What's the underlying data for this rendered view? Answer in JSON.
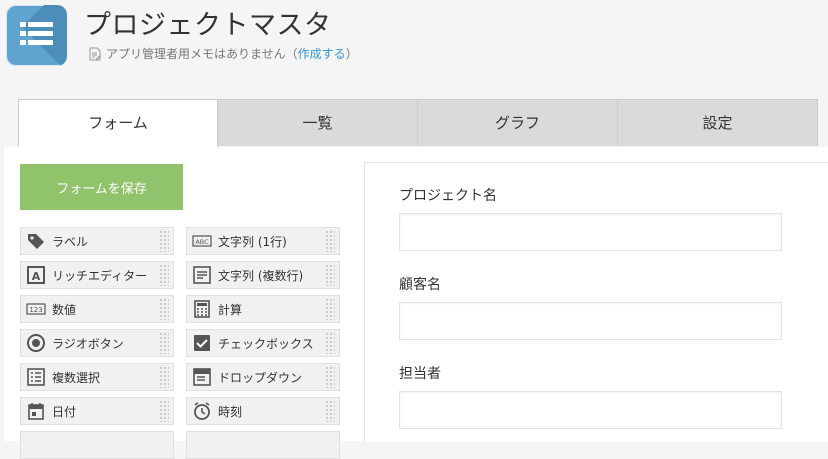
{
  "header": {
    "title": "プロジェクトマスタ",
    "memo_text": "アプリ管理者用メモはありません",
    "memo_open": "（",
    "memo_link": "作成する",
    "memo_close": "）"
  },
  "tabs": [
    {
      "label": "フォーム",
      "active": true
    },
    {
      "label": "一覧",
      "active": false
    },
    {
      "label": "グラフ",
      "active": false
    },
    {
      "label": "設定",
      "active": false
    }
  ],
  "toolbar": {
    "save_label": "フォームを保存"
  },
  "palette": [
    {
      "label": "ラベル",
      "icon": "tag-icon"
    },
    {
      "label": "文字列 (1行)",
      "icon": "abc-icon"
    },
    {
      "label": "リッチエディター",
      "icon": "rich-editor-icon"
    },
    {
      "label": "文字列 (複数行)",
      "icon": "multiline-text-icon"
    },
    {
      "label": "数値",
      "icon": "number-123-icon"
    },
    {
      "label": "計算",
      "icon": "calculator-icon"
    },
    {
      "label": "ラジオボタン",
      "icon": "radio-icon"
    },
    {
      "label": "チェックボックス",
      "icon": "checkbox-icon"
    },
    {
      "label": "複数選択",
      "icon": "multi-select-icon"
    },
    {
      "label": "ドロップダウン",
      "icon": "dropdown-icon"
    },
    {
      "label": "日付",
      "icon": "calendar-icon"
    },
    {
      "label": "時刻",
      "icon": "clock-icon"
    }
  ],
  "form_fields": [
    {
      "label": "プロジェクト名"
    },
    {
      "label": "顧客名"
    },
    {
      "label": "担当者"
    }
  ],
  "colors": {
    "accent_green": "#91c36c",
    "app_icon_blue": "#5fa3cf",
    "link_blue": "#3498db"
  }
}
